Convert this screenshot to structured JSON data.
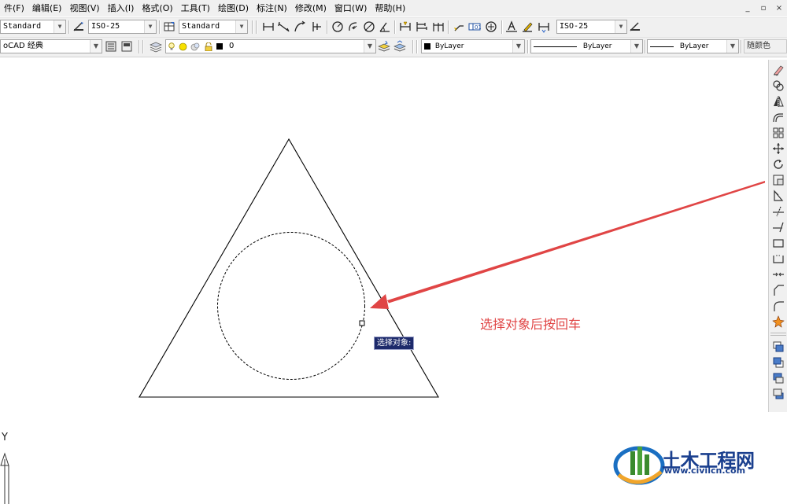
{
  "menu": {
    "items": [
      "件(F)",
      "编辑(E)",
      "视图(V)",
      "插入(I)",
      "格式(O)",
      "工具(T)",
      "绘图(D)",
      "标注(N)",
      "修改(M)",
      "窗口(W)",
      "帮助(H)"
    ]
  },
  "window_controls": [
    "_",
    "▫",
    "×"
  ],
  "toolbar1": {
    "text_style": "Standard",
    "dim_style": "ISO-25",
    "table_style": "Standard",
    "mleader_style": "ISO-25"
  },
  "toolbar2": {
    "workspace": "oCAD 经典",
    "layer_name": "0",
    "color": "ByLayer",
    "linetype": "ByLayer",
    "lineweight": "ByLayer",
    "plot_style": "随颜色"
  },
  "canvas": {
    "annotation": "选择对象后按回车",
    "tooltip": "选择对象:",
    "ucs_y_label": "Y",
    "annotation_color": "#e04545"
  },
  "watermark": {
    "name": "土木工程网",
    "url": "www.civilcn.com"
  }
}
